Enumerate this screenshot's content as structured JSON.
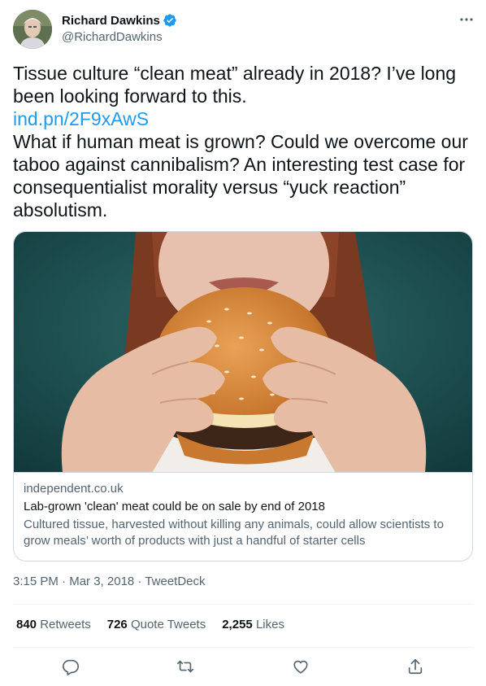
{
  "author": {
    "name": "Richard Dawkins",
    "handle": "@RichardDawkins",
    "verified_icon": "verified-badge-icon",
    "more_icon": "more-options-icon"
  },
  "tweet": {
    "line1": "Tissue culture “clean meat” already in 2018? I’ve long",
    "line2": "been looking forward to this.",
    "link": "ind.pn/2F9xAwS",
    "line3": "What if human meat is grown? Could we overcome our",
    "line4": "taboo against cannibalism? An interesting test case for",
    "line5": "consequentialist morality versus “yuck reaction”",
    "line6": "absolutism."
  },
  "card": {
    "domain": "independent.co.uk",
    "title": "Lab-grown 'clean' meat could be on sale by end of 2018",
    "description_line1": "Cultured tissue, harvested without killing any animals, could allow scientists to",
    "description_line2": "grow meals’ worth of products with just a handful of starter cells"
  },
  "meta": {
    "time": "3:15 PM",
    "sep1": " · ",
    "date": "Mar 3, 2018",
    "sep2": " · ",
    "client": "TweetDeck"
  },
  "stats": {
    "retweets_count": "840",
    "retweets_label": "Retweets",
    "quotes_count": "726",
    "quotes_label": "Quote Tweets",
    "likes_count": "2,255",
    "likes_label": "Likes"
  },
  "actions": [
    "reply-icon",
    "retweet-icon",
    "like-icon",
    "share-icon"
  ],
  "colors": {
    "link": "#1d9bf0",
    "secondary": "#536471",
    "primary": "#0f1419",
    "border": "#cfd9de"
  }
}
